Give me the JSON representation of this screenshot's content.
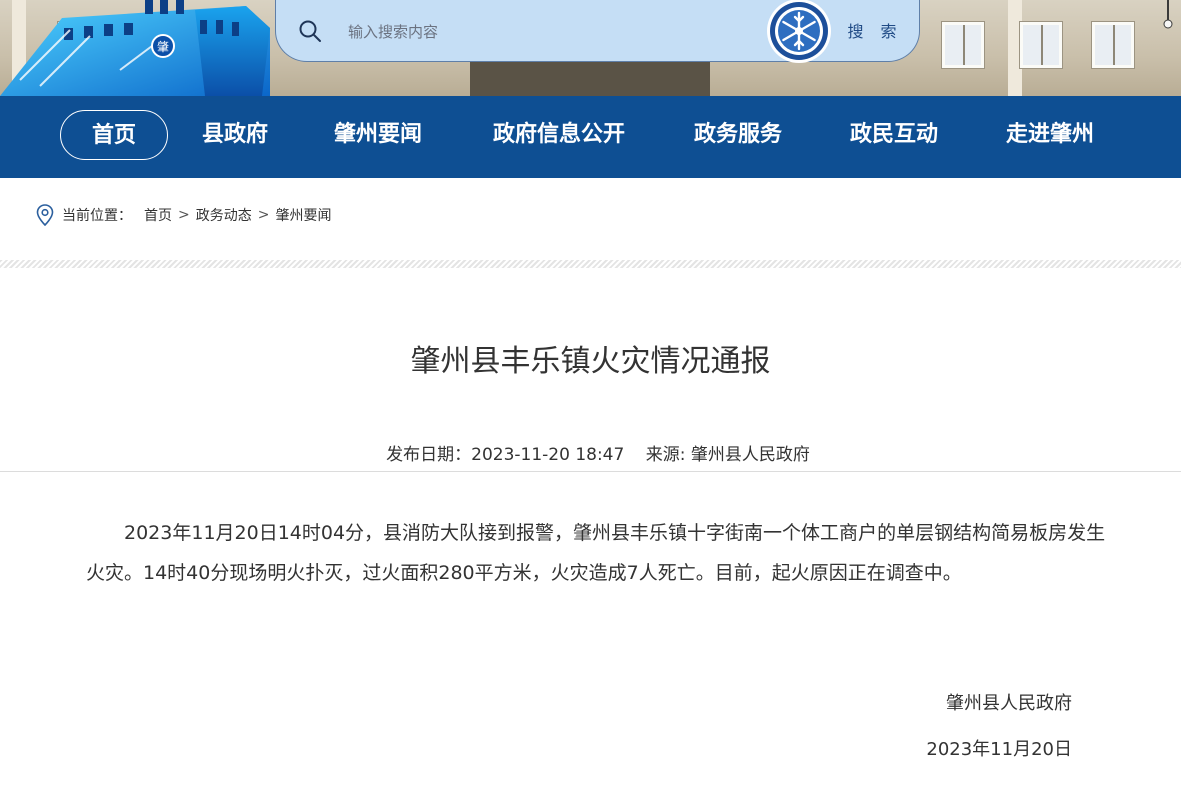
{
  "search": {
    "placeholder": "输入搜索内容",
    "button_label": "搜 索"
  },
  "logo": {
    "emblem_text": "肇"
  },
  "nav": {
    "items": [
      {
        "label": "首页",
        "active": true
      },
      {
        "label": "县政府"
      },
      {
        "label": "肇州要闻"
      },
      {
        "label": "政府信息公开"
      },
      {
        "label": "政务服务"
      },
      {
        "label": "政民互动"
      },
      {
        "label": "走进肇州"
      }
    ]
  },
  "breadcrumb": {
    "prefix": "当前位置：",
    "items": [
      "首页",
      "政务动态",
      "肇州要闻"
    ],
    "separator": ">"
  },
  "article": {
    "title": "肇州县丰乐镇火灾情况通报",
    "publish_label": "发布日期：2023-11-20 18:47",
    "source_label": "来源: 肇州县人民政府",
    "body": "2023年11月20日14时04分，县消防大队接到报警，肇州县丰乐镇十字街南一个体工商户的单层钢结构简易板房发生火灾。14时40分现场明火扑灭，过火面积280平方米，火灾造成7人死亡。目前，起火原因正在调查中。",
    "signature": "肇州县人民政府",
    "sign_date": "2023年11月20日"
  },
  "colors": {
    "nav_bg": "#0e4f93",
    "search_bg": "#c5def5",
    "search_button_text": "#1f4a85"
  },
  "icons": [
    "search-icon",
    "snowflake-emblem-icon",
    "location-pin-icon"
  ]
}
